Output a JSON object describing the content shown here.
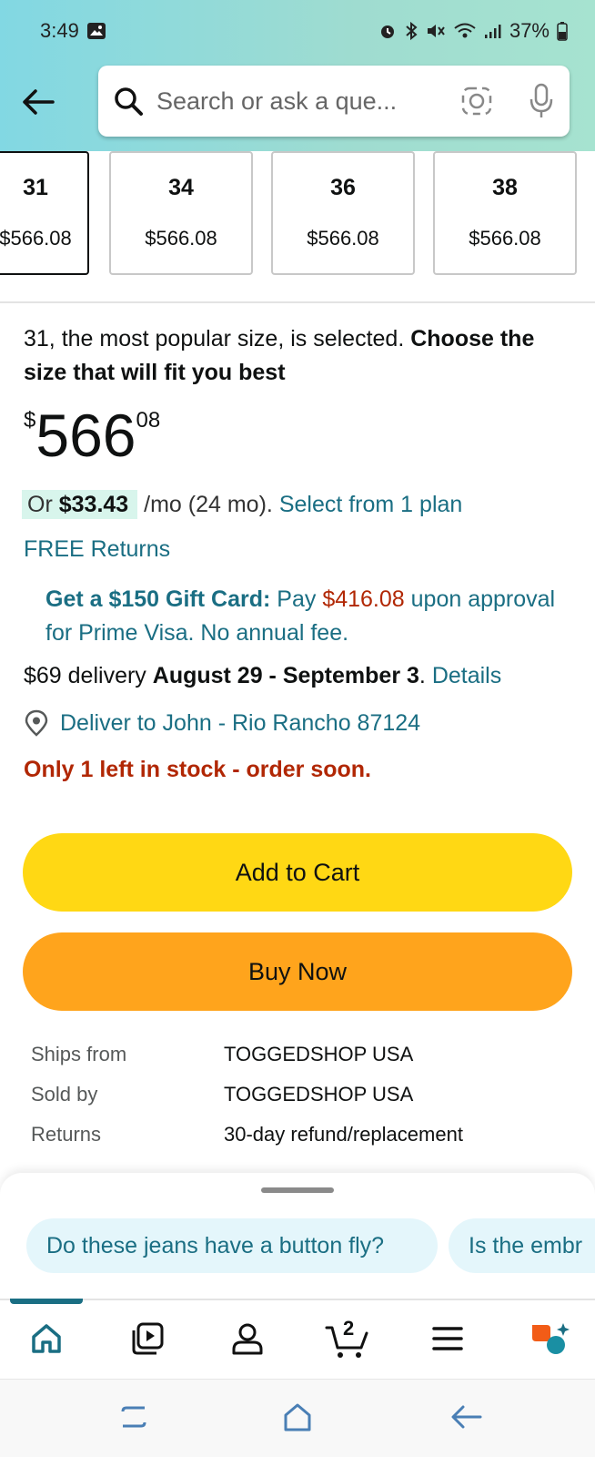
{
  "status_bar": {
    "time": "3:49",
    "battery": "37%"
  },
  "search": {
    "placeholder": "Search or ask a que..."
  },
  "sizes": [
    {
      "size": "31",
      "price": "$566.08",
      "selected": true
    },
    {
      "size": "34",
      "price": "$566.08",
      "selected": false
    },
    {
      "size": "36",
      "price": "$566.08",
      "selected": false
    },
    {
      "size": "38",
      "price": "$566.08",
      "selected": false
    }
  ],
  "product": {
    "selection_note": "31, the most popular size, is selected.",
    "selection_cta": "Choose the size that will fit you best",
    "price_symbol": "$",
    "price_whole": "566",
    "price_fraction": "08",
    "monthly_prefix": "Or",
    "monthly_amount": "$33.43",
    "monthly_suffix": "/mo (24 mo).",
    "plan_link": "Select from 1 plan",
    "free_returns": "FREE Returns",
    "gift_bold": "Get a $150 Gift Card:",
    "gift_pay": "Pay",
    "gift_amount": "$416.08",
    "gift_rest": "upon approval for Prime Visa. No annual fee.",
    "delivery_prefix": "$69 delivery",
    "delivery_dates": "August 29 - September 3",
    "delivery_dot": ".",
    "details_link": "Details",
    "deliver_to": "Deliver to John - Rio Rancho 87124",
    "stock": "Only 1 left in stock - order soon."
  },
  "buttons": {
    "add_to_cart": "Add to Cart",
    "buy_now": "Buy Now"
  },
  "info": {
    "ships_from_label": "Ships from",
    "ships_from_value": "TOGGEDSHOP USA",
    "sold_by_label": "Sold by",
    "sold_by_value": "TOGGEDSHOP USA",
    "returns_label": "Returns",
    "returns_value": "30-day refund/replacement"
  },
  "suggestions": [
    "Do these jeans have a button fly?",
    "Is the embr"
  ],
  "nav": {
    "cart_count": "2",
    "items": [
      "home-icon",
      "video-icon",
      "account-icon",
      "cart-icon",
      "menu-icon",
      "rufus-icon"
    ]
  },
  "colors": {
    "add_to_cart": "#ffd814",
    "buy_now": "#ffa41c",
    "link": "#1a6e83",
    "alert": "#b12704"
  }
}
